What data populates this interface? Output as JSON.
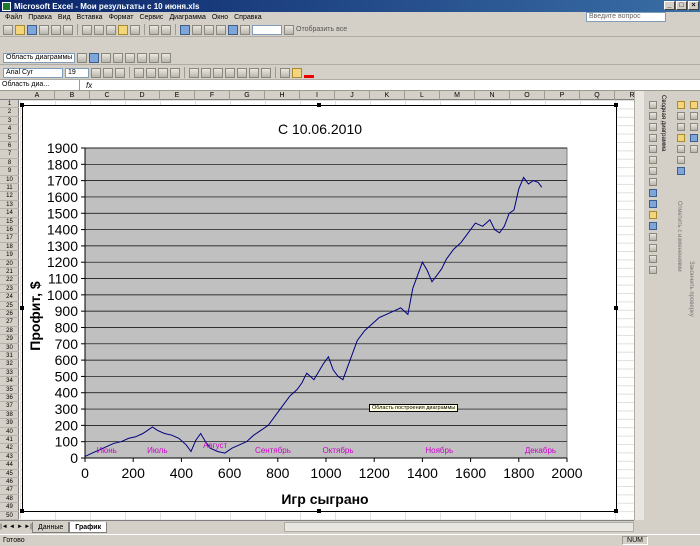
{
  "window": {
    "title": "Microsoft Excel - Мои результаты с 10 июня.xls"
  },
  "menu": {
    "items": [
      "Файл",
      "Правка",
      "Вид",
      "Вставка",
      "Формат",
      "Сервис",
      "Диаграмма",
      "Окно",
      "Справка"
    ],
    "ask_placeholder": "Введите вопрос"
  },
  "toolbar": {
    "show_all": "Отобразить все",
    "chart_area_selector": "Область диаграммы",
    "font_name": "Arial Cyr",
    "font_size": "19"
  },
  "formula_bar": {
    "name_box": "Область диа...",
    "fx": "fx"
  },
  "columns": [
    "A",
    "B",
    "C",
    "D",
    "E",
    "F",
    "G",
    "H",
    "I",
    "J",
    "K",
    "L",
    "M",
    "N",
    "O",
    "P",
    "Q",
    "R"
  ],
  "rows": [
    "1",
    "2",
    "3",
    "4",
    "5",
    "6",
    "7",
    "8",
    "9",
    "10",
    "11",
    "12",
    "13",
    "14",
    "15",
    "16",
    "17",
    "18",
    "19",
    "20",
    "21",
    "22",
    "23",
    "24",
    "25",
    "26",
    "27",
    "28",
    "29",
    "30",
    "31",
    "32",
    "33",
    "34",
    "35",
    "36",
    "37",
    "38",
    "39",
    "40",
    "41",
    "42",
    "43",
    "44",
    "45",
    "46",
    "47",
    "48",
    "49",
    "50"
  ],
  "sheet_tabs": [
    "Данные",
    "График"
  ],
  "active_sheet": "График",
  "status": {
    "ready": "Готово",
    "num": "NUM"
  },
  "side_toolbar": {
    "pivot_chart": "Сводная диаграмма",
    "show_changes": "Отметить с изменениями",
    "end_review": "Закончить проверку"
  },
  "tooltip": "Область построения диаграммы",
  "colors": {
    "plot_bg": "#c0c0c0",
    "series": "#000080",
    "month_labels": "#cc00cc"
  },
  "chart_data": {
    "type": "line",
    "title": "С 10.06.2010",
    "xlabel": "Игр сыграно",
    "ylabel": "Профит, $",
    "xlim": [
      0,
      2000
    ],
    "ylim": [
      0,
      1900
    ],
    "xticks": [
      0,
      200,
      400,
      600,
      800,
      1000,
      1200,
      1400,
      1600,
      1800,
      2000
    ],
    "yticks": [
      0,
      100,
      200,
      300,
      400,
      500,
      600,
      700,
      800,
      900,
      1000,
      1100,
      1200,
      1300,
      1400,
      1500,
      1600,
      1700,
      1800,
      1900
    ],
    "grid": "horizontal",
    "legend": "none",
    "month_annotations": [
      {
        "label": "Июнь",
        "x": 90,
        "y": 50
      },
      {
        "label": "Июль",
        "x": 300,
        "y": 50
      },
      {
        "label": "Август",
        "x": 540,
        "y": 80
      },
      {
        "label": "Сентябрь",
        "x": 780,
        "y": 50
      },
      {
        "label": "Октябрь",
        "x": 1050,
        "y": 50
      },
      {
        "label": "Ноябрь",
        "x": 1470,
        "y": 50
      },
      {
        "label": "Декабрь",
        "x": 1890,
        "y": 50
      }
    ],
    "series": [
      {
        "x": [
          0,
          30,
          60,
          90,
          120,
          150,
          180,
          210,
          240,
          260,
          280,
          300,
          330,
          360,
          390,
          420,
          440,
          460,
          480,
          500,
          520,
          550,
          580,
          610,
          640,
          670,
          700,
          730,
          760,
          790,
          820,
          850,
          880,
          900,
          920,
          935,
          950,
          970,
          990,
          1010,
          1030,
          1050,
          1070,
          1090,
          1110,
          1130,
          1160,
          1190,
          1220,
          1250,
          1280,
          1310,
          1340,
          1360,
          1380,
          1400,
          1420,
          1440,
          1460,
          1480,
          1500,
          1530,
          1560,
          1590,
          1620,
          1650,
          1680,
          1700,
          1720,
          1740,
          1760,
          1780,
          1800,
          1820,
          1840,
          1860,
          1880,
          1895
        ],
        "values": [
          10,
          30,
          50,
          70,
          90,
          100,
          120,
          130,
          150,
          170,
          190,
          170,
          150,
          140,
          120,
          80,
          40,
          110,
          150,
          100,
          60,
          40,
          30,
          60,
          80,
          100,
          140,
          170,
          200,
          260,
          320,
          380,
          420,
          460,
          520,
          500,
          480,
          530,
          580,
          620,
          540,
          500,
          480,
          560,
          640,
          720,
          780,
          820,
          860,
          880,
          900,
          920,
          880,
          1040,
          1120,
          1200,
          1150,
          1080,
          1120,
          1160,
          1220,
          1280,
          1320,
          1380,
          1440,
          1420,
          1460,
          1400,
          1380,
          1420,
          1500,
          1520,
          1650,
          1720,
          1680,
          1700,
          1690,
          1660
        ]
      }
    ]
  }
}
